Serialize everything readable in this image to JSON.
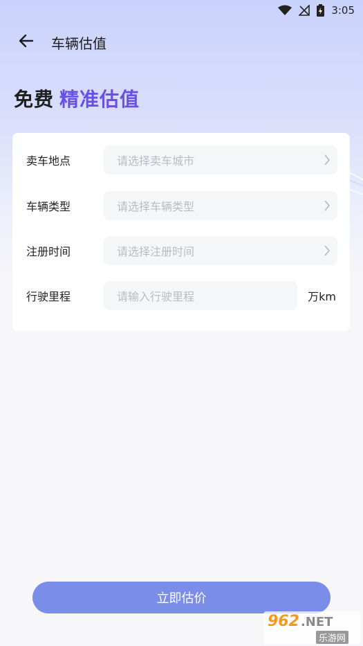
{
  "status_bar": {
    "time": "3:05"
  },
  "nav": {
    "title": "车辆估值",
    "back_icon": "arrow-left-icon"
  },
  "headline": {
    "part1": "免费",
    "part2": "精准估值"
  },
  "colors": {
    "accent_purple": "#6a4fe6",
    "button": "#7a8de8",
    "placeholder": "#b9bcc4"
  },
  "form": {
    "rows": [
      {
        "label": "卖车地点",
        "placeholder": "请选择卖车城市"
      },
      {
        "label": "车辆类型",
        "placeholder": "请选择车辆类型"
      },
      {
        "label": "注册时间",
        "placeholder": "请选择注册时间"
      },
      {
        "label": "行驶里程",
        "placeholder": "请输入行驶里程",
        "unit": "万km"
      }
    ]
  },
  "submit_label": "立即估价",
  "watermark": {
    "brand": "962",
    "suffix": ".NET",
    "sub": "乐游网"
  }
}
